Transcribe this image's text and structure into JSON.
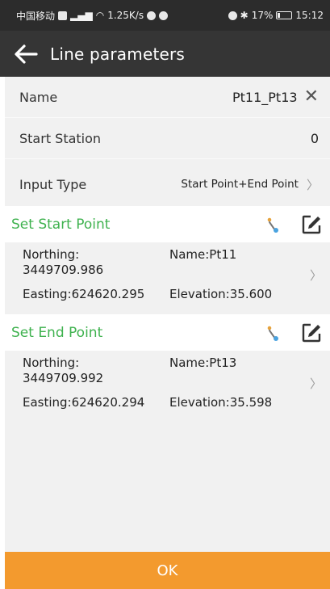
{
  "status_bar": {
    "carrier": "中国移动",
    "speed": "1.25K/s",
    "battery": "17%",
    "time": "15:12"
  },
  "header": {
    "title": "Line parameters",
    "back_icon": "arrow-left-icon"
  },
  "form": {
    "name_label": "Name",
    "name_value": "Pt11_Pt13",
    "start_station_label": "Start Station",
    "start_station_value": "0",
    "input_type_label": "Input Type",
    "input_type_value": "Start Point+End Point"
  },
  "start_point": {
    "heading": "Set Start Point",
    "northing_label": "Northing:",
    "northing_value": "3449709.986",
    "name": "Name:Pt11",
    "easting": "Easting:624620.295",
    "elevation": "Elevation:35.600"
  },
  "end_point": {
    "heading": "Set End Point",
    "northing_label": "Northing:",
    "northing_value": "3449709.992",
    "name": "Name:Pt13",
    "easting": "Easting:624620.294",
    "elevation": "Elevation:35.598"
  },
  "footer": {
    "ok_label": "OK"
  },
  "colors": {
    "accent_green": "#3fb24f",
    "ok_orange": "#f39a2e",
    "appbar": "#353535"
  }
}
